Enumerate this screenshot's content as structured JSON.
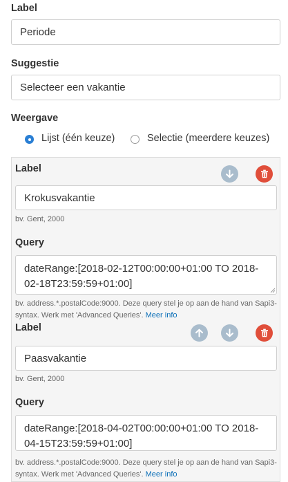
{
  "label_field": {
    "heading": "Label",
    "value": "Periode"
  },
  "suggestion_field": {
    "heading": "Suggestie",
    "value": "Selecteer een vakantie"
  },
  "display": {
    "heading": "Weergave",
    "options": [
      {
        "label": "Lijst (één keuze)",
        "selected": true
      },
      {
        "label": "Selectie (meerdere keuzes)",
        "selected": false
      }
    ]
  },
  "items": [
    {
      "label_heading": "Label",
      "label_value": "Krokusvakantie",
      "label_help": "bv. Gent, 2000",
      "query_heading": "Query",
      "query_value": "dateRange:[2018-02-12T00:00:00+01:00 TO 2018-02-18T23:59:59+01:00]",
      "query_help_text": "bv. address.*.postalCode:9000. Deze query stel je op aan de hand van Sapi3-syntax. Werk met 'Advanced Queries'.",
      "query_help_link": "Meer info"
    },
    {
      "label_heading": "Label",
      "label_value": "Paasvakantie",
      "label_help": "bv. Gent, 2000",
      "query_heading": "Query",
      "query_value": "dateRange:[2018-04-02T00:00:00+01:00 TO 2018-04-15T23:59:59+01:00]",
      "query_help_text": "bv. address.*.postalCode:9000. Deze query stel je op aan de hand van Sapi3-syntax. Werk met 'Advanced Queries'.",
      "query_help_link": "Meer info"
    }
  ],
  "colors": {
    "accent": "#2a7fd4",
    "danger": "#e04e3a",
    "muted_button": "#a9bccc",
    "link": "#0b6fb8"
  },
  "icons": {
    "move_down": "arrow-down-icon",
    "move_up": "arrow-up-icon",
    "delete": "trash-icon"
  }
}
